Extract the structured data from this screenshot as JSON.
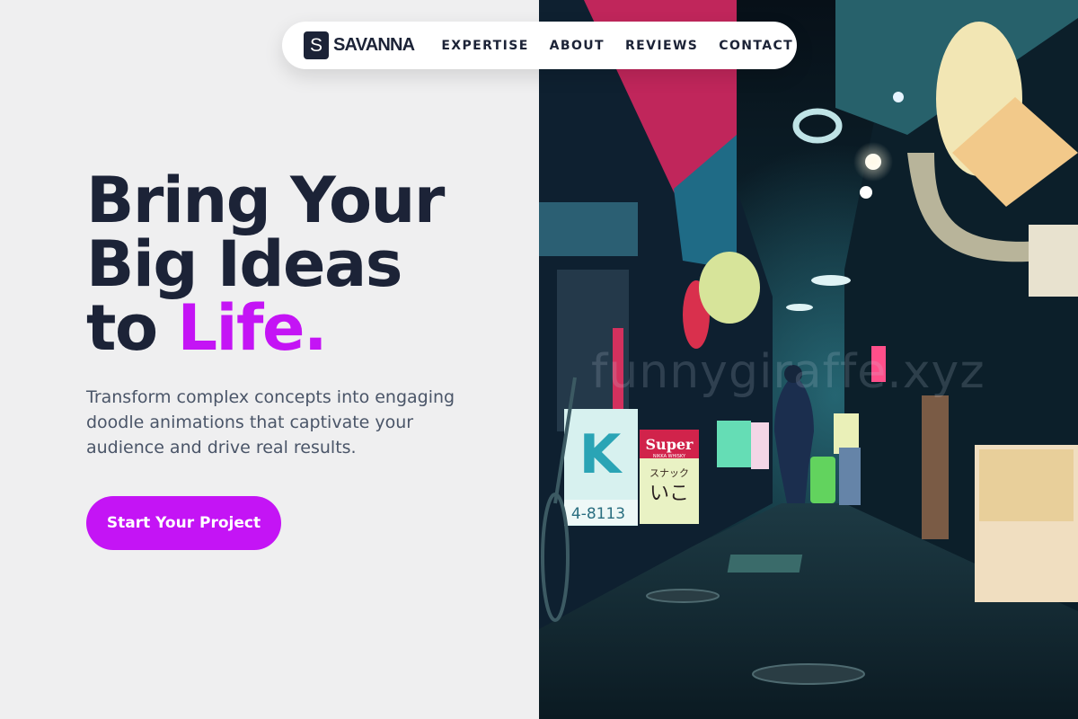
{
  "nav": {
    "logo_mark": "S",
    "logo_text": "SAVANNA",
    "links": [
      "EXPERTISE",
      "ABOUT",
      "REVIEWS",
      "CONTACT"
    ]
  },
  "hero": {
    "headline_line1": "Bring Your",
    "headline_line2": "Big Ideas",
    "headline_line3_prefix": "to ",
    "headline_line3_accent": "Life.",
    "subtext": "Transform complex concepts into engaging doodle animations that captivate your audience and drive real results.",
    "cta_label": "Start Your Project"
  },
  "photo": {
    "subject": "neon-lit night alley with shop signs",
    "sign_super": "Super",
    "sign_super_sub": "NIKKA WHISKY",
    "sign_snack_line1": "スナック",
    "sign_snack_line2": "いこ",
    "sign_k_letter": "K",
    "sign_k_phone": "4-8113",
    "watermark": "funnygiraffe.xyz"
  },
  "colors": {
    "accent": "#c414f5",
    "text_dark": "#1c2337",
    "text_muted": "#4a5568",
    "left_background": "#efeff0"
  }
}
